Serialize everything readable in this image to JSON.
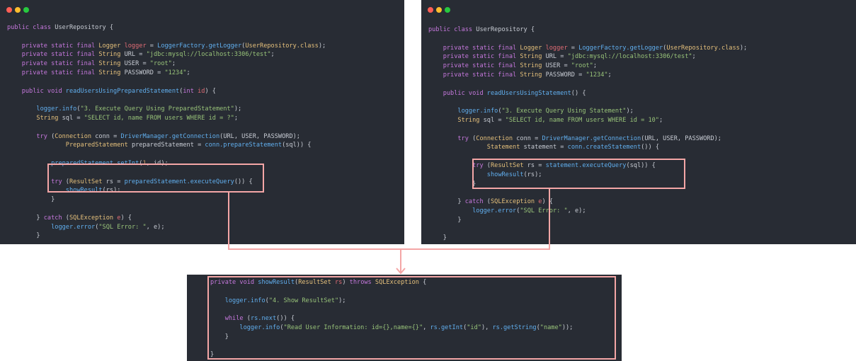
{
  "colors": {
    "panel_bg": "#282c34",
    "highlight": "#f4a6a6",
    "dot_red": "#ff5f56",
    "dot_yellow": "#ffbd2e",
    "dot_green": "#27c93f"
  },
  "panels": {
    "left": {
      "lines": [
        [
          [
            "kw",
            "public class "
          ],
          [
            "plain",
            "UserRepository {"
          ]
        ],
        [],
        [
          [
            "plain",
            "    "
          ],
          [
            "kw",
            "private static final "
          ],
          [
            "typ",
            "Logger "
          ],
          [
            "var",
            "logger"
          ],
          [
            "plain",
            " = "
          ],
          [
            "fn",
            "LoggerFactory.getLogger"
          ],
          [
            "plain",
            "("
          ],
          [
            "typ",
            "UserRepository.class"
          ],
          [
            "plain",
            ");"
          ]
        ],
        [
          [
            "plain",
            "    "
          ],
          [
            "kw",
            "private static final "
          ],
          [
            "typ",
            "String "
          ],
          [
            "plain",
            "URL = "
          ],
          [
            "str",
            "\"jdbc:mysql://localhost:3306/test\""
          ],
          [
            "plain",
            ";"
          ]
        ],
        [
          [
            "plain",
            "    "
          ],
          [
            "kw",
            "private static final "
          ],
          [
            "typ",
            "String "
          ],
          [
            "plain",
            "USER = "
          ],
          [
            "str",
            "\"root\""
          ],
          [
            "plain",
            ";"
          ]
        ],
        [
          [
            "plain",
            "    "
          ],
          [
            "kw",
            "private static final "
          ],
          [
            "typ",
            "String "
          ],
          [
            "plain",
            "PASSWORD = "
          ],
          [
            "str",
            "\"1234\""
          ],
          [
            "plain",
            ";"
          ]
        ],
        [],
        [
          [
            "plain",
            "    "
          ],
          [
            "kw",
            "public void "
          ],
          [
            "fn",
            "readUsersUsingPreparedStatement"
          ],
          [
            "plain",
            "("
          ],
          [
            "kw",
            "int "
          ],
          [
            "var",
            "id"
          ],
          [
            "plain",
            ") {"
          ]
        ],
        [],
        [
          [
            "plain",
            "        "
          ],
          [
            "fn",
            "logger.info"
          ],
          [
            "plain",
            "("
          ],
          [
            "str",
            "\"3. Execute Query Using PreparedStatement\""
          ],
          [
            "plain",
            ");"
          ]
        ],
        [
          [
            "plain",
            "        "
          ],
          [
            "typ",
            "String "
          ],
          [
            "plain",
            "sql = "
          ],
          [
            "str",
            "\"SELECT id, name FROM users WHERE id = ?\""
          ],
          [
            "plain",
            ";"
          ]
        ],
        [],
        [
          [
            "plain",
            "        "
          ],
          [
            "kw",
            "try "
          ],
          [
            "plain",
            "("
          ],
          [
            "typ",
            "Connection "
          ],
          [
            "plain",
            "conn = "
          ],
          [
            "fn",
            "DriverManager.getConnection"
          ],
          [
            "plain",
            "(URL, USER, PASSWORD);"
          ]
        ],
        [
          [
            "plain",
            "                "
          ],
          [
            "typ",
            "PreparedStatement "
          ],
          [
            "plain",
            "preparedStatement = "
          ],
          [
            "fn",
            "conn.prepareStatement"
          ],
          [
            "plain",
            "(sql)) {"
          ]
        ],
        [],
        [
          [
            "plain",
            "            "
          ],
          [
            "fn",
            "preparedStatement.setInt"
          ],
          [
            "plain",
            "("
          ],
          [
            "num",
            "1"
          ],
          [
            "plain",
            ", id);"
          ]
        ],
        [],
        [
          [
            "plain",
            "            "
          ],
          [
            "kw",
            "try "
          ],
          [
            "plain",
            "("
          ],
          [
            "typ",
            "ResultSet "
          ],
          [
            "plain",
            "rs = "
          ],
          [
            "fn",
            "preparedStatement.executeQuery"
          ],
          [
            "plain",
            "()) {"
          ]
        ],
        [
          [
            "plain",
            "                "
          ],
          [
            "fn",
            "showResult"
          ],
          [
            "plain",
            "(rs);"
          ]
        ],
        [
          [
            "plain",
            "            }"
          ]
        ],
        [],
        [
          [
            "plain",
            "        } "
          ],
          [
            "kw",
            "catch "
          ],
          [
            "plain",
            "("
          ],
          [
            "typ",
            "SQLException "
          ],
          [
            "var",
            "e"
          ],
          [
            "plain",
            ") {"
          ]
        ],
        [
          [
            "plain",
            "            "
          ],
          [
            "fn",
            "logger.error"
          ],
          [
            "plain",
            "("
          ],
          [
            "str",
            "\"SQL Error: \""
          ],
          [
            "plain",
            ", e);"
          ]
        ],
        [
          [
            "plain",
            "        }"
          ]
        ],
        [],
        [
          [
            "plain",
            "    }"
          ]
        ]
      ]
    },
    "right": {
      "lines": [
        [
          [
            "kw",
            "public class "
          ],
          [
            "plain",
            "UserRepository {"
          ]
        ],
        [],
        [
          [
            "plain",
            "    "
          ],
          [
            "kw",
            "private static final "
          ],
          [
            "typ",
            "Logger "
          ],
          [
            "var",
            "logger"
          ],
          [
            "plain",
            " = "
          ],
          [
            "fn",
            "LoggerFactory.getLogger"
          ],
          [
            "plain",
            "("
          ],
          [
            "typ",
            "UserRepository.class"
          ],
          [
            "plain",
            ");"
          ]
        ],
        [
          [
            "plain",
            "    "
          ],
          [
            "kw",
            "private static final "
          ],
          [
            "typ",
            "String "
          ],
          [
            "plain",
            "URL = "
          ],
          [
            "str",
            "\"jdbc:mysql://localhost:3306/test\""
          ],
          [
            "plain",
            ";"
          ]
        ],
        [
          [
            "plain",
            "    "
          ],
          [
            "kw",
            "private static final "
          ],
          [
            "typ",
            "String "
          ],
          [
            "plain",
            "USER = "
          ],
          [
            "str",
            "\"root\""
          ],
          [
            "plain",
            ";"
          ]
        ],
        [
          [
            "plain",
            "    "
          ],
          [
            "kw",
            "private static final "
          ],
          [
            "typ",
            "String "
          ],
          [
            "plain",
            "PASSWORD = "
          ],
          [
            "str",
            "\"1234\""
          ],
          [
            "plain",
            ";"
          ]
        ],
        [],
        [
          [
            "plain",
            "    "
          ],
          [
            "kw",
            "public void "
          ],
          [
            "fn",
            "readUsersUsingStatement"
          ],
          [
            "plain",
            "() {"
          ]
        ],
        [],
        [
          [
            "plain",
            "        "
          ],
          [
            "fn",
            "logger.info"
          ],
          [
            "plain",
            "("
          ],
          [
            "str",
            "\"3. Execute Query Using Statement\""
          ],
          [
            "plain",
            ");"
          ]
        ],
        [
          [
            "plain",
            "        "
          ],
          [
            "typ",
            "String "
          ],
          [
            "plain",
            "sql = "
          ],
          [
            "str",
            "\"SELECT id, name FROM users WHERE id = 10\""
          ],
          [
            "plain",
            ";"
          ]
        ],
        [],
        [
          [
            "plain",
            "        "
          ],
          [
            "kw",
            "try "
          ],
          [
            "plain",
            "("
          ],
          [
            "typ",
            "Connection "
          ],
          [
            "plain",
            "conn = "
          ],
          [
            "fn",
            "DriverManager.getConnection"
          ],
          [
            "plain",
            "(URL, USER, PASSWORD);"
          ]
        ],
        [
          [
            "plain",
            "                "
          ],
          [
            "typ",
            "Statement "
          ],
          [
            "plain",
            "statement = "
          ],
          [
            "fn",
            "conn.createStatement"
          ],
          [
            "plain",
            "()) {"
          ]
        ],
        [],
        [
          [
            "plain",
            "            "
          ],
          [
            "kw",
            "try "
          ],
          [
            "plain",
            "("
          ],
          [
            "typ",
            "ResultSet "
          ],
          [
            "plain",
            "rs = "
          ],
          [
            "fn",
            "statement.executeQuery"
          ],
          [
            "plain",
            "(sql)) {"
          ]
        ],
        [
          [
            "plain",
            "                "
          ],
          [
            "fn",
            "showResult"
          ],
          [
            "plain",
            "(rs);"
          ]
        ],
        [
          [
            "plain",
            "            }"
          ]
        ],
        [],
        [
          [
            "plain",
            "        } "
          ],
          [
            "kw",
            "catch "
          ],
          [
            "plain",
            "("
          ],
          [
            "typ",
            "SQLException "
          ],
          [
            "var",
            "e"
          ],
          [
            "plain",
            ") {"
          ]
        ],
        [
          [
            "plain",
            "            "
          ],
          [
            "fn",
            "logger.error"
          ],
          [
            "plain",
            "("
          ],
          [
            "str",
            "\"SQL Error: \""
          ],
          [
            "plain",
            ", e);"
          ]
        ],
        [
          [
            "plain",
            "        }"
          ]
        ],
        [],
        [
          [
            "plain",
            "    }"
          ]
        ]
      ]
    },
    "bottom": {
      "lines": [
        [
          [
            "kw",
            "private void "
          ],
          [
            "fn",
            "showResult"
          ],
          [
            "plain",
            "("
          ],
          [
            "typ",
            "ResultSet "
          ],
          [
            "var",
            "rs"
          ],
          [
            "plain",
            ") "
          ],
          [
            "kw",
            "throws "
          ],
          [
            "typ",
            "SQLException"
          ],
          [
            "plain",
            " {"
          ]
        ],
        [],
        [
          [
            "plain",
            "    "
          ],
          [
            "fn",
            "logger.info"
          ],
          [
            "plain",
            "("
          ],
          [
            "str",
            "\"4. Show ResultSet\""
          ],
          [
            "plain",
            ");"
          ]
        ],
        [],
        [
          [
            "plain",
            "    "
          ],
          [
            "kw",
            "while "
          ],
          [
            "plain",
            "("
          ],
          [
            "fn",
            "rs.next"
          ],
          [
            "plain",
            "()) {"
          ]
        ],
        [
          [
            "plain",
            "        "
          ],
          [
            "fn",
            "logger.info"
          ],
          [
            "plain",
            "("
          ],
          [
            "str",
            "\"Read User Information: id={},name={}\""
          ],
          [
            "plain",
            ", "
          ],
          [
            "fn",
            "rs.getInt"
          ],
          [
            "plain",
            "("
          ],
          [
            "str",
            "\"id\""
          ],
          [
            "plain",
            "), "
          ],
          [
            "fn",
            "rs.getString"
          ],
          [
            "plain",
            "("
          ],
          [
            "str",
            "\"name\""
          ],
          [
            "plain",
            "));"
          ]
        ],
        [
          [
            "plain",
            "    }"
          ]
        ],
        [],
        [
          [
            "plain",
            "}"
          ]
        ]
      ]
    }
  }
}
